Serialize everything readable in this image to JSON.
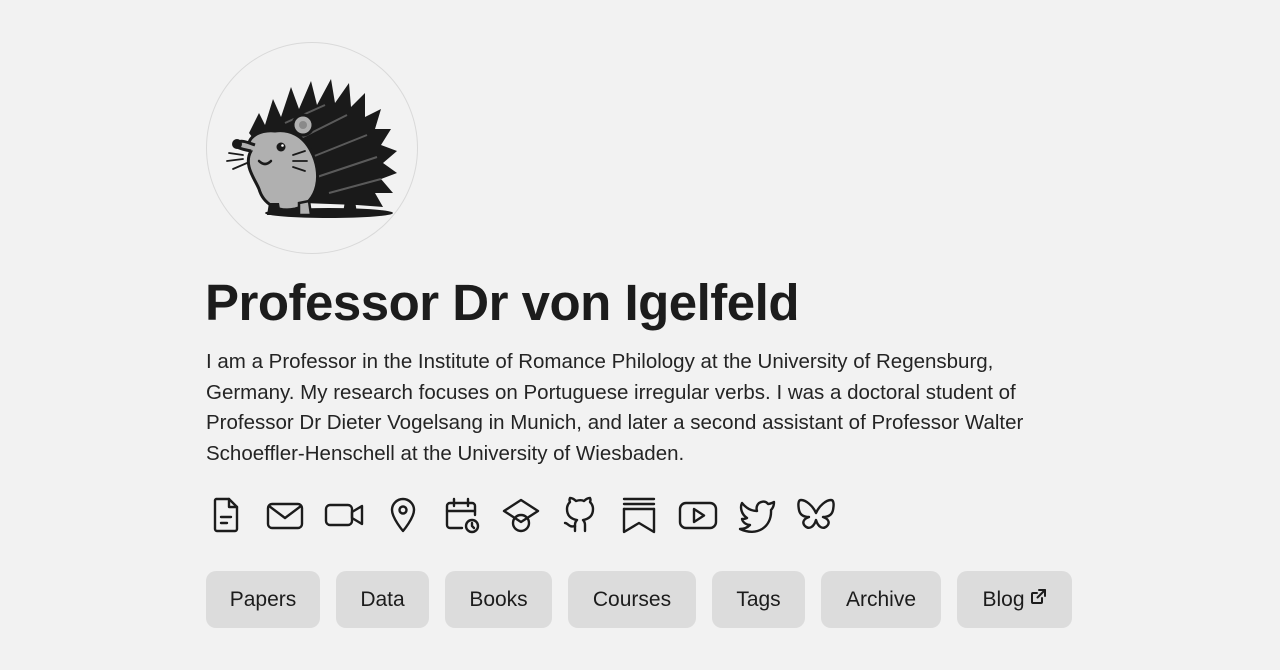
{
  "profile": {
    "name": "Professor Dr von Igelfeld",
    "bio": "I am a Professor in the Institute of Romance Philology at the University of Regensburg, Germany. My research focuses on Portuguese irregular verbs. I was a doctoral student of Professor Dr Dieter Vogelsang in Munich, and later a second assistant of Professor Walter Schoeffler-Henschell at the University of Wiesbaden.",
    "avatar_icon": "hedgehog-avatar"
  },
  "icons": [
    {
      "name": "cv-document-icon"
    },
    {
      "name": "email-icon"
    },
    {
      "name": "video-call-icon"
    },
    {
      "name": "location-pin-icon"
    },
    {
      "name": "calendar-clock-icon"
    },
    {
      "name": "graduation-cap-icon"
    },
    {
      "name": "github-icon"
    },
    {
      "name": "bookmark-stack-icon"
    },
    {
      "name": "youtube-icon"
    },
    {
      "name": "twitter-icon"
    },
    {
      "name": "bluesky-butterfly-icon"
    }
  ],
  "nav": {
    "papers": "Papers",
    "data": "Data",
    "books": "Books",
    "courses": "Courses",
    "tags": "Tags",
    "archive": "Archive",
    "blog": "Blog"
  },
  "colors": {
    "background": "#f2f2f2",
    "button": "#dcdcdc",
    "text": "#1c1c1c"
  }
}
